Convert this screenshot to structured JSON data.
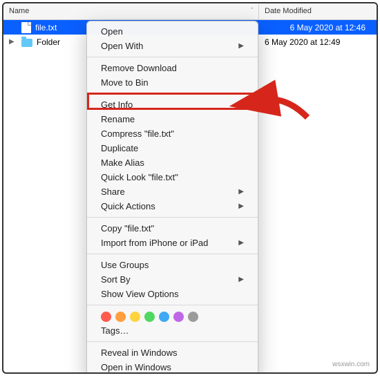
{
  "header": {
    "name_col": "Name",
    "date_col": "Date Modified",
    "sort_indicator": "ˆ"
  },
  "rows": [
    {
      "name": "file.txt",
      "date": "6 May 2020 at 12:46",
      "type": "file",
      "selected": true
    },
    {
      "name": "Folder",
      "date": "6 May 2020 at 12:49",
      "type": "folder",
      "selected": false
    }
  ],
  "menu": {
    "groups": [
      [
        {
          "label": "Open",
          "submenu": false
        },
        {
          "label": "Open With",
          "submenu": true
        }
      ],
      [
        {
          "label": "Remove Download",
          "submenu": false
        },
        {
          "label": "Move to Bin",
          "submenu": false
        }
      ],
      [
        {
          "label": "Get Info",
          "submenu": false
        },
        {
          "label": "Rename",
          "submenu": false
        },
        {
          "label": "Compress \"file.txt\"",
          "submenu": false
        },
        {
          "label": "Duplicate",
          "submenu": false
        },
        {
          "label": "Make Alias",
          "submenu": false
        },
        {
          "label": "Quick Look \"file.txt\"",
          "submenu": false
        },
        {
          "label": "Share",
          "submenu": true
        },
        {
          "label": "Quick Actions",
          "submenu": true
        }
      ],
      [
        {
          "label": "Copy \"file.txt\"",
          "submenu": false
        },
        {
          "label": "Import from iPhone or iPad",
          "submenu": true
        }
      ],
      [
        {
          "label": "Use Groups",
          "submenu": false
        },
        {
          "label": "Sort By",
          "submenu": true
        },
        {
          "label": "Show View Options",
          "submenu": false
        }
      ]
    ],
    "tags_label": "Tags…",
    "tag_colors": [
      "#ff5b4f",
      "#ff9e3e",
      "#ffd33e",
      "#4fd862",
      "#3fa9f5",
      "#c066e8",
      "#9b9b9b"
    ],
    "footer": [
      {
        "label": "Reveal in Windows",
        "submenu": false
      },
      {
        "label": "Open in Windows",
        "submenu": false
      }
    ]
  },
  "watermark": "wsxwin.com",
  "highlight_target": "Get Info"
}
